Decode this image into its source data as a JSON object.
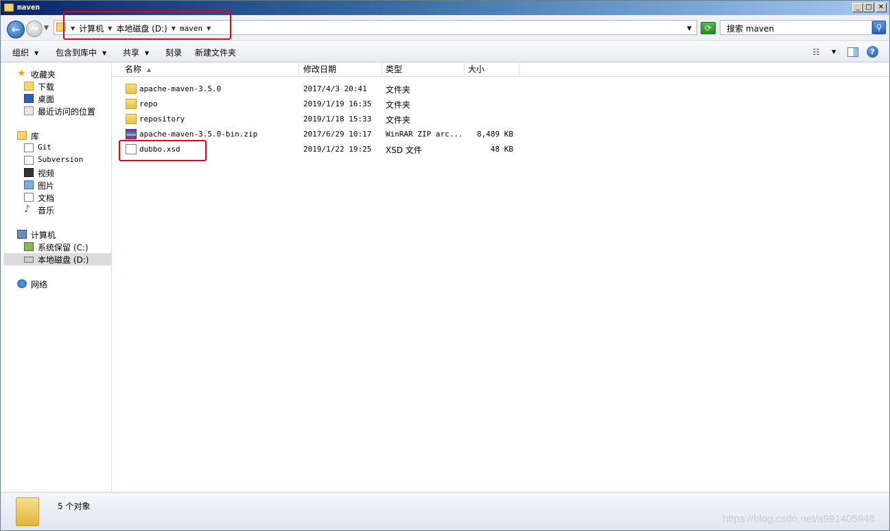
{
  "window": {
    "title": "maven",
    "min_glyph": "_",
    "max_glyph": "□",
    "close_glyph": "✕"
  },
  "address": {
    "crumbs": [
      "计算机",
      "本地磁盘 (D:)",
      "maven"
    ]
  },
  "search": {
    "placeholder": "搜索 maven"
  },
  "toolbar": {
    "organize": "组织",
    "include_in_library": "包含到库中",
    "share": "共享",
    "burn": "刻录",
    "new_folder": "新建文件夹"
  },
  "navpane": {
    "favorites": {
      "label": "收藏夹",
      "items": [
        "下载",
        "桌面",
        "最近访问的位置"
      ]
    },
    "libraries": {
      "label": "库",
      "items": [
        "Git",
        "Subversion",
        "视频",
        "图片",
        "文档",
        "音乐"
      ]
    },
    "computer": {
      "label": "计算机",
      "items": [
        "系统保留 (C:)",
        "本地磁盘 (D:)"
      ]
    },
    "network": {
      "label": "网络"
    }
  },
  "columns": {
    "name": "名称",
    "date": "修改日期",
    "type": "类型",
    "size": "大小"
  },
  "files": [
    {
      "name": "apache-maven-3.5.0",
      "date": "2017/4/3 20:41",
      "type": "文件夹",
      "size": "",
      "icon": "folder-icon"
    },
    {
      "name": "repo",
      "date": "2019/1/19 16:35",
      "type": "文件夹",
      "size": "",
      "icon": "folder-icon"
    },
    {
      "name": "repository",
      "date": "2019/1/18 15:33",
      "type": "文件夹",
      "size": "",
      "icon": "folder-icon"
    },
    {
      "name": "apache-maven-3.5.0-bin.zip",
      "date": "2017/6/29 10:17",
      "type": "WinRAR ZIP arc...",
      "size": "8,489 KB",
      "icon": "winrar-archive-icon"
    },
    {
      "name": "dubbo.xsd",
      "date": "2019/1/22 19:25",
      "type": "XSD 文件",
      "size": "48 KB",
      "icon": "xsd-file-icon"
    }
  ],
  "status": {
    "count": "5 个对象"
  },
  "watermark": "https://blog.csdn.net/a991405948",
  "colors": {
    "annotation": "#e60012",
    "selected_nav": "#dcdcdc"
  }
}
